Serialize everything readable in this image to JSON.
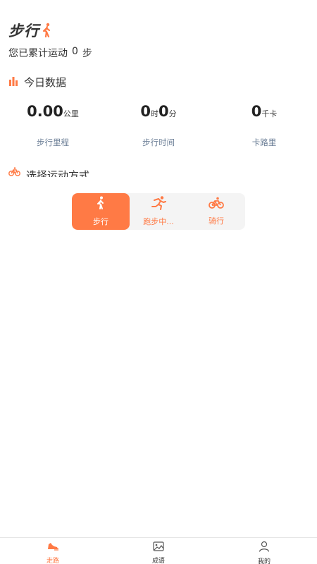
{
  "header": {
    "title": "步行",
    "icon": "walker-icon"
  },
  "summary": {
    "prefix": "您已累计运动",
    "steps": "0",
    "suffix": "步"
  },
  "today": {
    "heading": "今日数据",
    "icon": "bar-chart-icon",
    "stats": [
      {
        "value": "0.00",
        "unit": "公里",
        "label": "步行里程"
      },
      {
        "value_h": "0",
        "unit_h": "时",
        "value_m": "0",
        "unit_m": "分",
        "label": "步行时间"
      },
      {
        "value": "0",
        "unit": "千卡",
        "label": "卡路里"
      }
    ]
  },
  "mode_section": {
    "heading": "选择运动方式",
    "icon": "bicycle-icon"
  },
  "modes": [
    {
      "label": "步行",
      "icon": "walker-icon",
      "active": true
    },
    {
      "label": "跑步中...",
      "icon": "runner-icon",
      "active": false
    },
    {
      "label": "骑行",
      "icon": "bicycle-icon",
      "active": false
    }
  ],
  "tabbar": [
    {
      "label": "走路",
      "icon": "shoe-icon",
      "active": true
    },
    {
      "label": "成语",
      "icon": "image-icon",
      "active": false
    },
    {
      "label": "我的",
      "icon": "person-icon",
      "active": false
    }
  ],
  "colors": {
    "accent": "#ff7a45",
    "label_gray": "#6b7e96"
  }
}
